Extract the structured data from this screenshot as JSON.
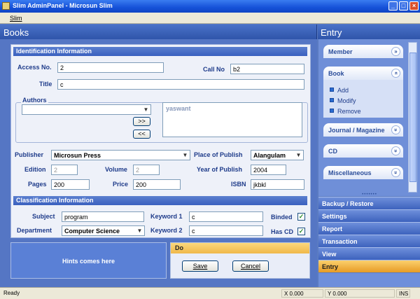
{
  "window": {
    "title": "Slim AdminPanel - Microsun Slim"
  },
  "menu": {
    "items": [
      "Slim"
    ]
  },
  "books": {
    "title": "Books"
  },
  "ident": {
    "section": "Identification Information",
    "access_label": "Access No.",
    "access_value": "2",
    "callno_label": "Call No",
    "callno_value": "b2",
    "title_label": "Title",
    "title_value": "c",
    "authors_label": "Authors",
    "authors_selected": "",
    "add_author": ">>",
    "remove_author": "<<",
    "author_list": [
      "yaswant"
    ],
    "publisher_label": "Publisher",
    "publisher_value": "Microsun Press",
    "place_label": "Place of Publish",
    "place_value": "Alangulam",
    "edition_label": "Edition",
    "edition_value": "2",
    "volume_label": "Volume",
    "volume_value": "2",
    "year_label": "Year of Publish",
    "year_value": "2004",
    "pages_label": "Pages",
    "pages_value": "200",
    "price_label": "Price",
    "price_value": "200",
    "isbn_label": "ISBN",
    "isbn_value": "jkbkl"
  },
  "classif": {
    "section": "Classification Information",
    "subject_label": "Subject",
    "subject_value": "program",
    "keyword1_label": "Keyword 1",
    "keyword1_value": "c",
    "binded_label": "Binded",
    "binded_checked": true,
    "department_label": "Department",
    "department_value": "Computer Science",
    "keyword2_label": "Keyword 2",
    "keyword2_value": "c",
    "hascd_label": "Has CD",
    "hascd_checked": true
  },
  "hints": {
    "text": "Hints comes here"
  },
  "do": {
    "title": "Do",
    "save": "Save",
    "cancel": "Cancel"
  },
  "entry": {
    "title": "Entry",
    "groups": [
      {
        "label": "Member",
        "icon": "chevron-down-icon"
      },
      {
        "label": "Book",
        "icon": "chevron-up-icon"
      },
      {
        "label": "Journal / Magazine",
        "icon": "chevron-down-icon"
      },
      {
        "label": "CD",
        "icon": "chevron-down-icon"
      },
      {
        "label": "Miscellaneous",
        "icon": "chevron-down-icon"
      }
    ],
    "book_items": [
      "Add",
      "Modify",
      "Remove"
    ]
  },
  "nav": [
    "Backup / Restore",
    "Settings",
    "Report",
    "Transaction",
    "View",
    "Entry"
  ],
  "status": {
    "text": "Ready",
    "x": "X 0.000",
    "y": "Y 0.000",
    "ins": "INS"
  },
  "colors": {
    "accent": "#3a60bf",
    "active_nav": "#f0a93a",
    "title_bar": "#1551d8"
  }
}
